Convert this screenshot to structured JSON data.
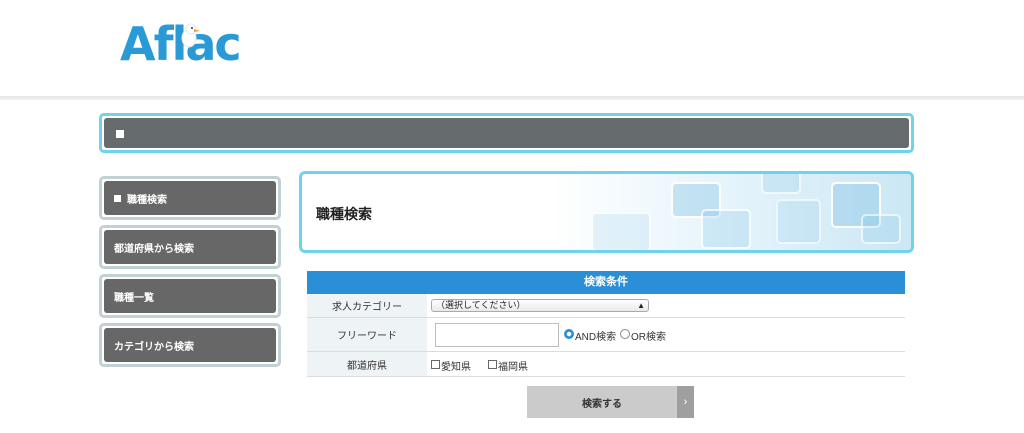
{
  "logo": {
    "text": "Aflac"
  },
  "sidebar": {
    "items": [
      {
        "label": "職種検索",
        "active": true
      },
      {
        "label": "都道府県から検索"
      },
      {
        "label": "職種一覧"
      },
      {
        "label": "カテゴリから検索"
      }
    ]
  },
  "main": {
    "title": "職種検索"
  },
  "search": {
    "header": "検索条件",
    "category_label": "求人カテゴリー",
    "category_selected": "（選択してください）",
    "freeword_label": "フリーワード",
    "freeword_value": "",
    "mode_and": "AND検索",
    "mode_or": "OR検索",
    "mode_selected": "AND",
    "prefecture_label": "都道府県",
    "prefectures": [
      "愛知県",
      "福岡県"
    ],
    "submit_label": "検索する"
  },
  "colors": {
    "brand": "#2a9ad6",
    "accent_border": "#6fd3ec",
    "header_bar": "#2a8fd6",
    "button_bg": "#676767"
  }
}
